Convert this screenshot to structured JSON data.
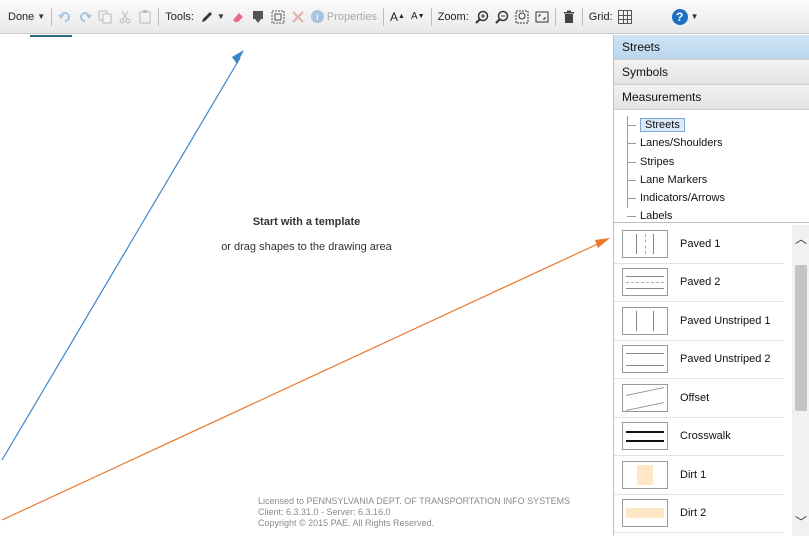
{
  "toolbar": {
    "done_label": "Done",
    "tools_label": "Tools:",
    "properties_label": "Properties",
    "zoom_label": "Zoom:",
    "grid_label": "Grid:",
    "font_increase": "A",
    "font_decrease": "A"
  },
  "canvas": {
    "title": "Start with a template",
    "subtitle": "or drag shapes to the drawing area",
    "license_line1": "Licensed to PENNSYLVANIA DEPT. OF TRANSPORTATION INFO SYSTEMS",
    "license_line2": "Client: 6.3.31.0 - Server: 6.3.16.0",
    "license_line3": "Copyright © 2015 PAE. All Rights Reserved."
  },
  "panel": {
    "categories": [
      "Streets",
      "Symbols",
      "Measurements"
    ],
    "tree": [
      "Streets",
      "Lanes/Shoulders",
      "Stripes",
      "Lane Markers",
      "Indicators/Arrows",
      "Labels"
    ],
    "shapes": [
      "Paved 1",
      "Paved 2",
      "Paved Unstriped 1",
      "Paved Unstriped 2",
      "Offset",
      "Crosswalk",
      "Dirt 1",
      "Dirt 2"
    ]
  },
  "colors": {
    "arrow_blue": "#3a86c8",
    "arrow_orange": "#e8792c",
    "help_icon": "#1f6fc1"
  }
}
